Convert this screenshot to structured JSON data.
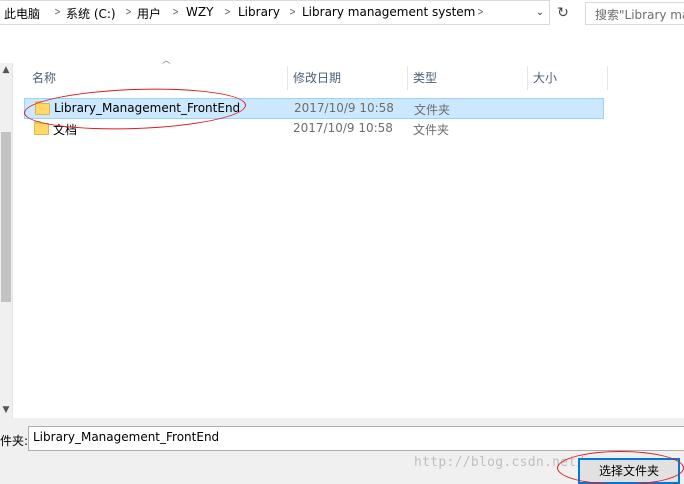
{
  "address_bar": {
    "crumbs": [
      "此电脑",
      "系统 (C:)",
      "用户",
      "WZY",
      "Library",
      "Library management system"
    ]
  },
  "search": {
    "placeholder": "搜索\"Library ma"
  },
  "columns": {
    "name": "名称",
    "date": "修改日期",
    "type": "类型",
    "size": "大小"
  },
  "rows": [
    {
      "name": "Library_Management_FrontEnd",
      "date": "2017/10/9 10:58",
      "type": "文件夹",
      "selected": true
    },
    {
      "name": "文档",
      "date": "2017/10/9 10:58",
      "type": "文件夹",
      "selected": false
    }
  ],
  "footer": {
    "folder_label": "件夹:",
    "folder_value": "Library_Management_FrontEnd",
    "select_button": "选择文件夹",
    "watermark": "http://blog.csdn.net/w..."
  },
  "annotations": {
    "ellipse_color": "#e0191f"
  }
}
